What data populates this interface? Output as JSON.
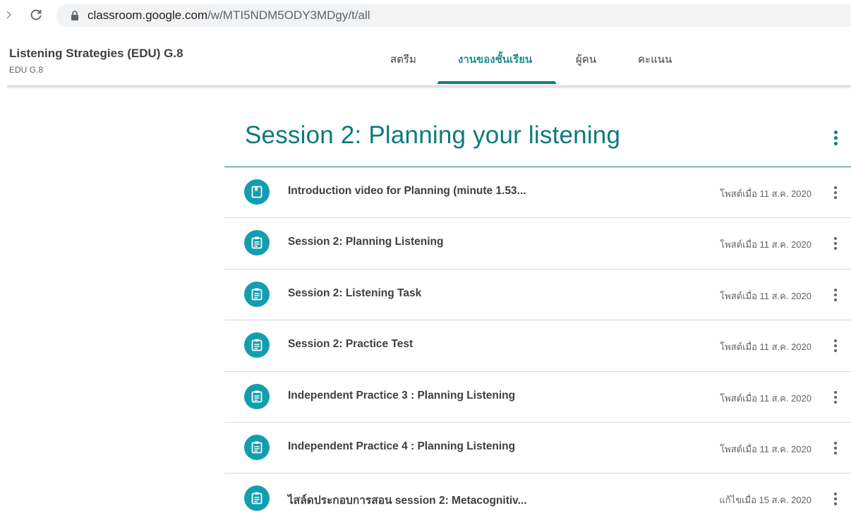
{
  "browser": {
    "url_host": "classroom.google.com",
    "url_path": "/w/MTI5NDM5ODY3MDgy/t/all"
  },
  "header": {
    "class_title": "Listening Strategies (EDU) G.8",
    "class_section": "EDU G.8",
    "tabs": [
      {
        "label": "สตรีม",
        "active": false
      },
      {
        "label": "งานของชั้นเรียน",
        "active": true
      },
      {
        "label": "ผู้คน",
        "active": false
      },
      {
        "label": "คะแนน",
        "active": false
      }
    ]
  },
  "topic": {
    "title": "Session 2: Planning your listening"
  },
  "items": [
    {
      "title": "Introduction video for Planning (minute 1.53...",
      "date": "โพสต์เมื่อ 11 ส.ค. 2020",
      "icon": "material-icon"
    },
    {
      "title": "Session 2: Planning Listening",
      "date": "โพสต์เมื่อ 11 ส.ค. 2020",
      "icon": "assignment-icon"
    },
    {
      "title": "Session 2: Listening Task",
      "date": "โพสต์เมื่อ 11 ส.ค. 2020",
      "icon": "assignment-icon"
    },
    {
      "title": "Session 2: Practice Test",
      "date": "โพสต์เมื่อ 11 ส.ค. 2020",
      "icon": "assignment-icon"
    },
    {
      "title": "Independent Practice 3 : Planning Listening",
      "date": "โพสต์เมื่อ 11 ส.ค. 2020",
      "icon": "assignment-icon"
    },
    {
      "title": "Independent Practice 4 : Planning Listening",
      "date": "โพสต์เมื่อ 11 ส.ค. 2020",
      "icon": "assignment-icon"
    },
    {
      "title": "ไสล์ดประกอบการสอน session 2: Metacognitiv...",
      "date": "แก้ไขเมื่อ 15 ส.ค. 2020",
      "icon": "assignment-icon"
    }
  ],
  "colors": {
    "accent": "#0d7a7a",
    "icon_bg": "#129eaf"
  }
}
